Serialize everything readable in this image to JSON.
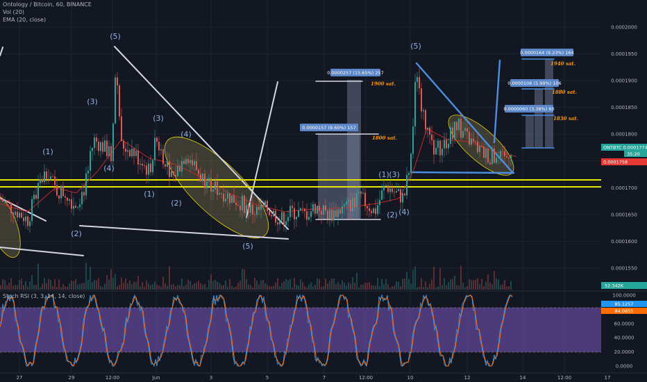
{
  "header": {
    "title": "Ontology / Bitcoin, 60, BINANCE",
    "vol": "Vol (20)",
    "ema": "EMA (20, close)",
    "rsi": "Stoch RSI (3, 3, 14, 14, close)"
  },
  "chart_data": {
    "type": "candlestick",
    "symbol": "ONTBTC",
    "interval": "60",
    "exchange": "BINANCE",
    "ylim": [
      0.000152,
      0.000203
    ],
    "y_ticks": [
      "0.0002000",
      "0.0001950",
      "0.0001900",
      "0.0001850",
      "0.0001800",
      "0.0001750",
      "0.0001700",
      "0.0001650",
      "0.0001600",
      "0.0001550"
    ],
    "x_ticks": [
      "27",
      "29",
      "12:00",
      "Jun",
      "3",
      "5",
      "7",
      "12:00",
      "10",
      "12",
      "14",
      "12:00",
      "17"
    ],
    "price_path": [
      [
        0,
        0.000168
      ],
      [
        20,
        0.000166
      ],
      [
        40,
        0.000164
      ],
      [
        55,
        0.00017
      ],
      [
        68,
        0.0001735
      ],
      [
        80,
        0.0001695
      ],
      [
        95,
        0.000169
      ],
      [
        108,
        0.0001668
      ],
      [
        122,
        0.00017
      ],
      [
        135,
        0.000179
      ],
      [
        150,
        0.0001775
      ],
      [
        160,
        0.000176
      ],
      [
        167,
        0.000193
      ],
      [
        175,
        0.000178
      ],
      [
        190,
        0.000177
      ],
      [
        205,
        0.0001745
      ],
      [
        215,
        0.000173
      ],
      [
        225,
        0.000179
      ],
      [
        235,
        0.000176
      ],
      [
        250,
        0.000172
      ],
      [
        268,
        0.0001765
      ],
      [
        290,
        0.000172
      ],
      [
        310,
        0.00017
      ],
      [
        335,
        0.000168
      ],
      [
        350,
        0.000167
      ],
      [
        365,
        0.0001655
      ],
      [
        385,
        0.000166
      ],
      [
        405,
        0.000164
      ],
      [
        420,
        0.0001655
      ],
      [
        440,
        0.000165
      ],
      [
        455,
        0.0001665
      ],
      [
        475,
        0.000165
      ],
      [
        500,
        0.0001665
      ],
      [
        520,
        0.000168
      ],
      [
        540,
        0.0001655
      ],
      [
        555,
        0.0001705
      ],
      [
        570,
        0.000169
      ],
      [
        582,
        0.000168
      ],
      [
        592,
        0.000176
      ],
      [
        600,
        0.0001925
      ],
      [
        610,
        0.000183
      ],
      [
        625,
        0.000177
      ],
      [
        640,
        0.000178
      ],
      [
        658,
        0.000182
      ],
      [
        675,
        0.000179
      ],
      [
        695,
        0.0001765
      ],
      [
        715,
        0.0001755
      ],
      [
        728,
        0.0001752
      ],
      [
        738,
        0.0001778
      ]
    ],
    "ema_path": [
      [
        0,
        0.000167
      ],
      [
        40,
        0.0001655
      ],
      [
        80,
        0.00017
      ],
      [
        110,
        0.000169
      ],
      [
        140,
        0.000173
      ],
      [
        175,
        0.000179
      ],
      [
        215,
        0.0001755
      ],
      [
        250,
        0.0001745
      ],
      [
        290,
        0.000172
      ],
      [
        330,
        0.000169
      ],
      [
        370,
        0.0001668
      ],
      [
        410,
        0.0001655
      ],
      [
        450,
        0.000166
      ],
      [
        500,
        0.0001663
      ],
      [
        540,
        0.000167
      ],
      [
        575,
        0.000168
      ],
      [
        595,
        0.000173
      ],
      [
        615,
        0.000181
      ],
      [
        645,
        0.000179
      ],
      [
        680,
        0.0001785
      ],
      [
        710,
        0.0001768
      ],
      [
        745,
        0.0001758
      ]
    ],
    "horizontal_levels": [
      {
        "label": "0.0001714",
        "value": 0.0001714,
        "color": "#e6e600"
      },
      {
        "label": "0.0001704",
        "value": 0.0001704,
        "color": "#e6e600"
      }
    ],
    "price_tags": [
      {
        "label": "ONTBTC",
        "value_label": "0.0001774",
        "sub_label": "35:20",
        "value": 0.0001774,
        "color": "#26a69a"
      },
      {
        "label": "",
        "value_label": "0.0001758",
        "value": 0.0001758,
        "color": "#e53935"
      }
    ],
    "volume_label": "52.342K",
    "measure_boxes": [
      {
        "label": "0.0000157 (9.60%) 157",
        "note": "1800 sat."
      },
      {
        "label": "0.0000257 (15.65%) 257",
        "note": "1900 sat."
      },
      {
        "label": "0.0000164 (9.23%) 164",
        "note": "1940 sat."
      },
      {
        "label": "0.0000106 (5.99%) 106",
        "note": "1880 sat."
      },
      {
        "label": "0.0000060 (3.38%) 60",
        "note": "1830 sat."
      }
    ],
    "wave_labels": [
      "(1)",
      "(2)",
      "(3)",
      "(4)",
      "(5)",
      "(1)",
      "(2)",
      "(3)",
      "(4)",
      "(5)",
      "(1)",
      "(2)",
      "(3)",
      "(4)",
      "(5)"
    ],
    "stoch_rsi": {
      "ylim": [
        0,
        100
      ],
      "ticks": [
        "100.0000",
        "80.0000",
        "60.0000",
        "40.0000",
        "20.0000",
        "0.0000"
      ],
      "k_label": "85.1257",
      "d_label": "84.0855",
      "upper_band": 80,
      "lower_band": 20
    }
  }
}
